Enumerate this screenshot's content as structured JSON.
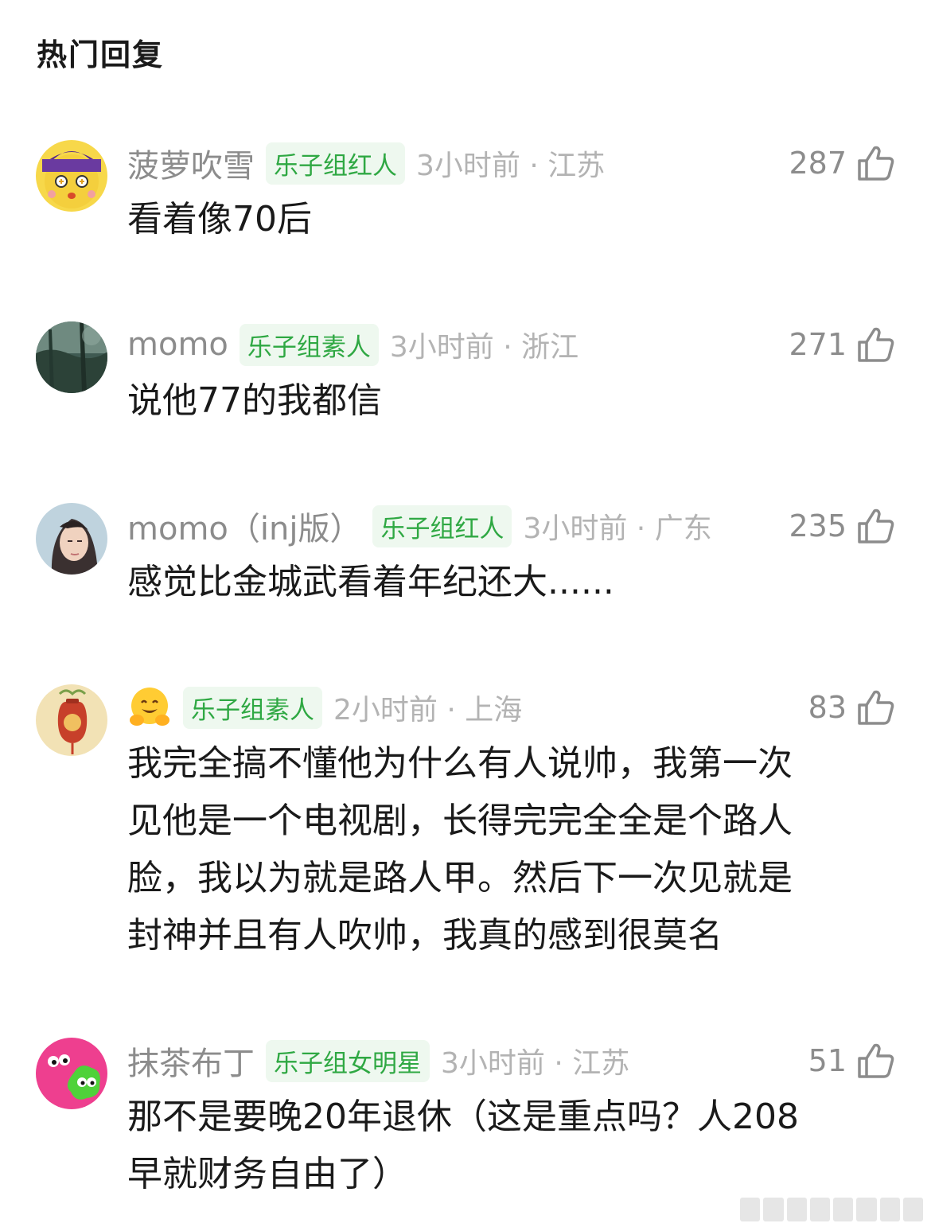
{
  "section_title": "热门回复",
  "comments": [
    {
      "username": "菠萝吹雪",
      "badge": "乐子组红人",
      "time_location": "3小时前 · 江苏",
      "likes": "287",
      "text": "看着像70后",
      "avatar_icon": "cartoon-character-avatar"
    },
    {
      "username": "momo",
      "badge": "乐子组素人",
      "time_location": "3小时前 · 浙江",
      "likes": "271",
      "text": "说他77的我都信",
      "avatar_icon": "forest-scene-avatar"
    },
    {
      "username": "momo（inj版）",
      "badge": "乐子组红人",
      "time_location": "3小时前 · 广东",
      "likes": "235",
      "text": "感觉比金城武看着年纪还大......",
      "avatar_icon": "portrait-avatar"
    },
    {
      "username": "",
      "username_icon": "hugging-face-emoji",
      "badge": "乐子组素人",
      "time_location": "2小时前 · 上海",
      "likes": "83",
      "text": "我完全搞不懂他为什么有人说帅，我第一次\n见他是一个电视剧，长得完完全全是个路人\n脸，我以为就是路人甲。然后下一次见就是\n封神并且有人吹帅，我真的感到很莫名",
      "avatar_icon": "lucky-bag-avatar"
    },
    {
      "username": "抹茶布丁",
      "badge": "乐子组女明星",
      "time_location": "3小时前 · 江苏",
      "likes": "51",
      "text": "那不是要晚20年退休（这是重点吗？人208\n早就财务自由了）",
      "avatar_icon": "splat-characters-avatar"
    }
  ],
  "colors": {
    "badge_text": "#2fa843",
    "badge_bg": "#eef8ef",
    "meta_gray": "#8c8c8c",
    "time_gray": "#b3b3b3"
  }
}
